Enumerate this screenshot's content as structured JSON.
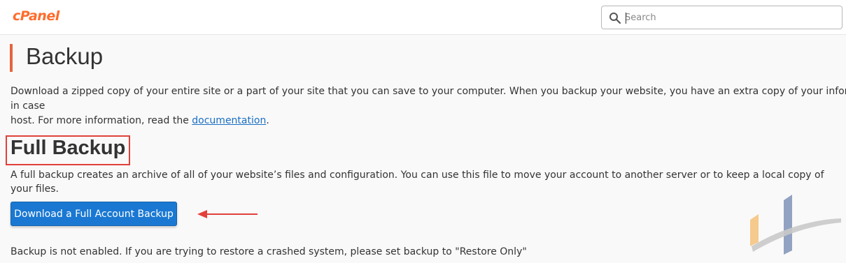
{
  "header": {
    "logo_text": "cPanel",
    "search_placeholder": "Search"
  },
  "page": {
    "title": "Backup",
    "intro_text": "Download a zipped copy of your entire site or a part of your site that you can save to your computer. When you backup your website, you have an extra copy of your information in case",
    "intro_text_2": "host. For more information, read the ",
    "intro_link": "documentation",
    "intro_end": "."
  },
  "full_backup": {
    "title": "Full Backup",
    "description": "A full backup creates an archive of all of your website’s files and configuration. You can use this file to move your account to another server or to keep a local copy of your files.",
    "button_label": "Download a Full Account Backup",
    "status_text": "Backup is not enabled. If you are trying to restore a crashed system, please set backup to \"Restore Only\""
  },
  "colors": {
    "accent": "#e5643e",
    "button": "#1a78d2",
    "highlight": "#e2403a",
    "link": "#1a6fc4"
  }
}
